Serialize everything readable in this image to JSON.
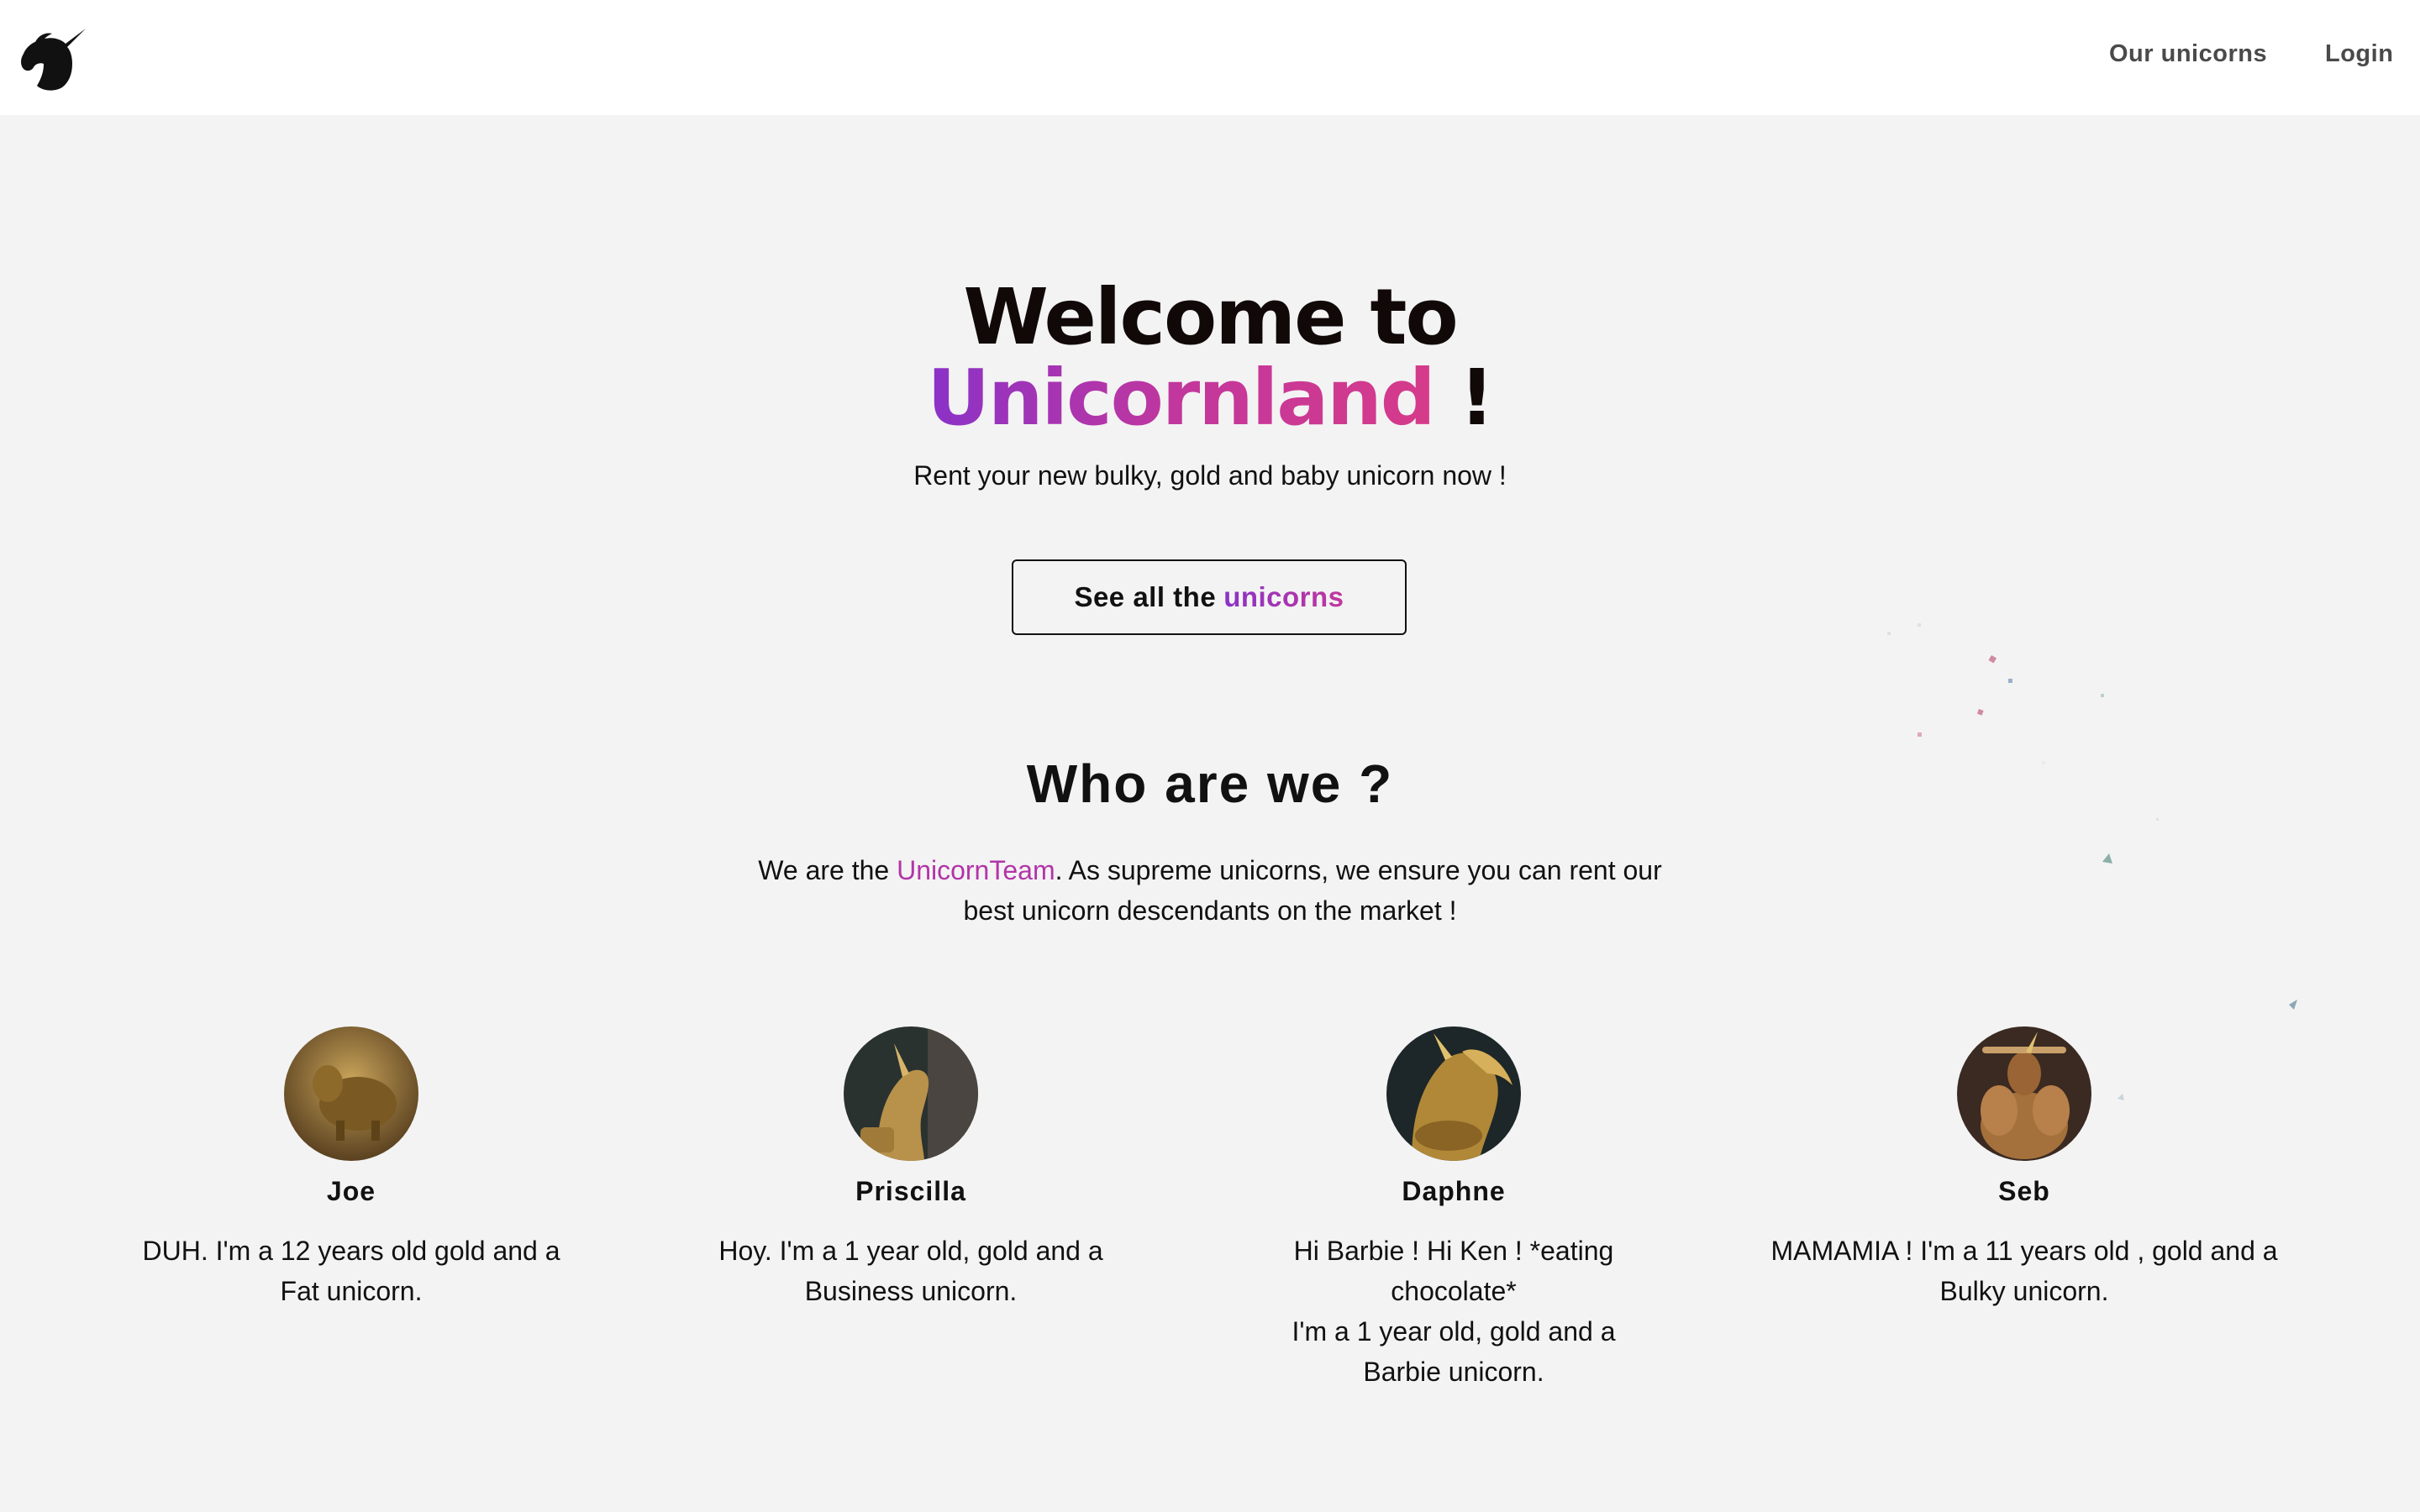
{
  "header": {
    "logo_icon": "unicorn-head-icon",
    "nav": [
      {
        "label": "Our unicorns"
      },
      {
        "label": "Login"
      }
    ]
  },
  "hero": {
    "title_line1": "Welcome to",
    "title_brand": "Unicornland",
    "title_suffix": " !",
    "subtitle": "Rent your new bulky, gold and baby unicorn now !",
    "cta_prefix": "See all the",
    "cta_accent": "unicorns"
  },
  "about": {
    "title": "Who are we ?",
    "text_before": "We are the ",
    "team_name": "UnicornTeam",
    "text_after": ". As supreme unicorns, we ensure you can rent our best unicorn descendants on the market !"
  },
  "team": [
    {
      "name": "Joe",
      "description": "DUH. I'm a 12 years old gold and a Fat unicorn."
    },
    {
      "name": "Priscilla",
      "description": "Hoy. I'm a 1 year old, gold and a Business unicorn."
    },
    {
      "name": "Daphne",
      "description": "Hi Barbie ! Hi Ken ! *eating chocolate*\nI'm a 1 year old, gold and a Barbie unicorn."
    },
    {
      "name": "Seb",
      "description": "MAMAMIA ! I'm a 11 years old , gold and a Bulky unicorn."
    }
  ],
  "colors": {
    "brand_gradient_start": "#8a32c8",
    "brand_gradient_end": "#d63b8a",
    "team_accent": "#b234a8",
    "page_bg": "#f3f3f3"
  }
}
